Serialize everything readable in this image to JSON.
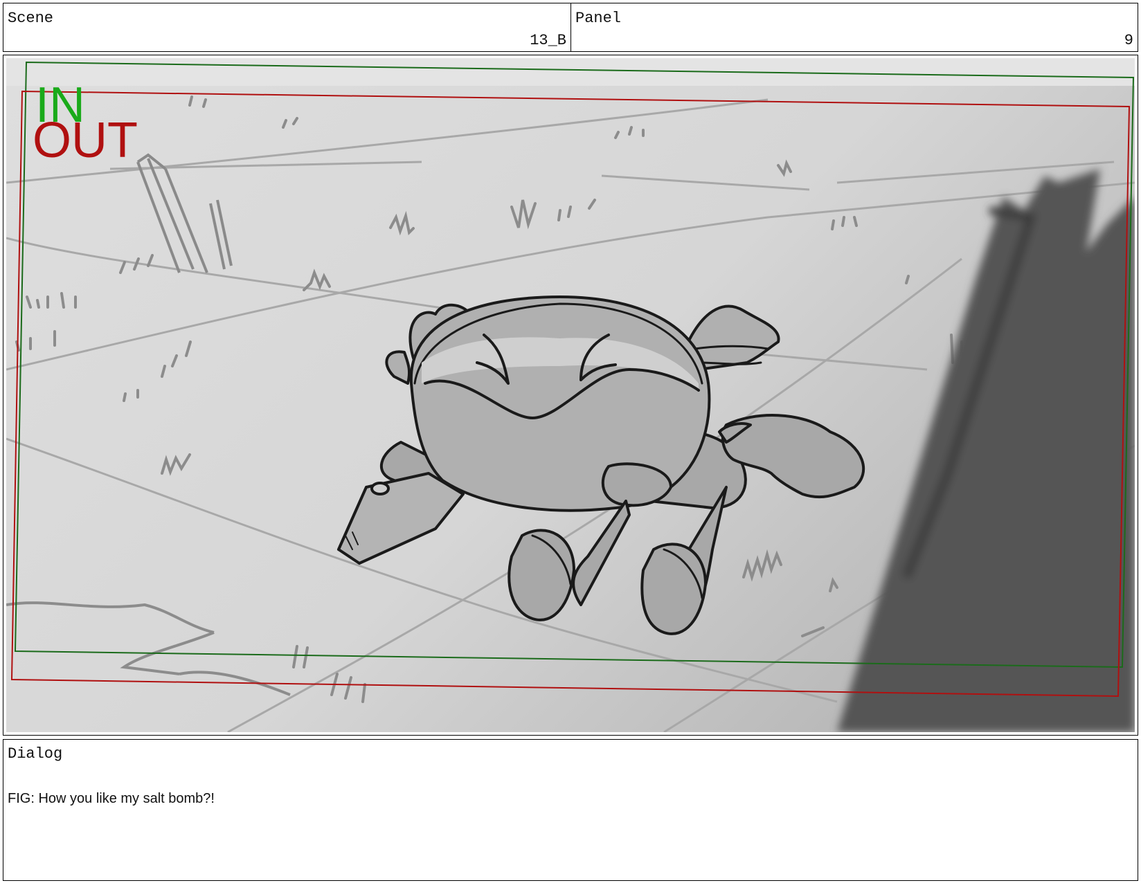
{
  "header": {
    "scene_label": "Scene",
    "scene_value": "13_B",
    "panel_label": "Panel",
    "panel_value": "9"
  },
  "frame": {
    "in_label": "IN",
    "out_label": "OUT",
    "in_color": "#1aaa1a",
    "out_color": "#b01010"
  },
  "dialog": {
    "label": "Dialog",
    "text": "FIG: How you like my salt bomb?!"
  }
}
